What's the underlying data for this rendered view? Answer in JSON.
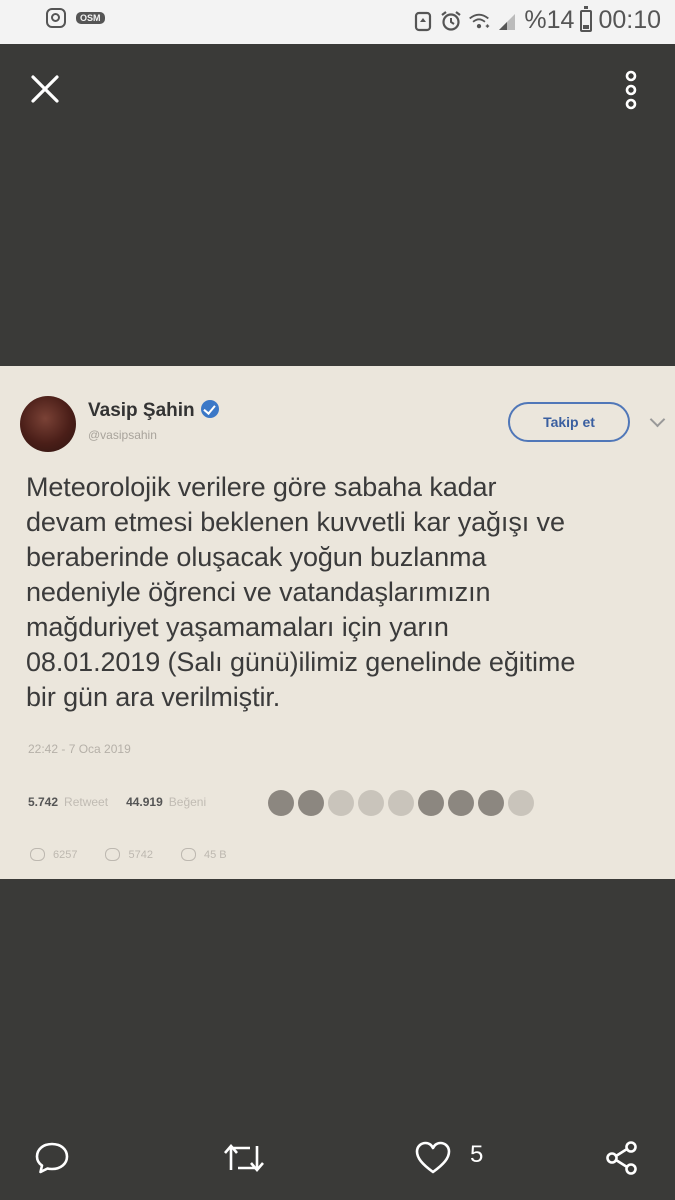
{
  "status_bar": {
    "left_icons": [
      "instagram-icon",
      "osm-app-icon"
    ],
    "osm_label": "OSM",
    "battery_text": "%14",
    "time": "00:10",
    "right_icons": [
      "recycle-icon",
      "alarm-icon",
      "wifi-icon",
      "signal-icon",
      "battery-icon"
    ]
  },
  "viewer": {
    "close_icon": "close-icon",
    "menu_icon": "more-vert-icon"
  },
  "tweet_photo": {
    "user_name": "Vasip Şahin",
    "verified_icon": "verified-badge-icon",
    "handle": "@vasipsahin",
    "follow_label": "Takip et",
    "caret_icon": "chevron-down-icon",
    "text": "Meteorolojik verilere göre sabaha kadar\ndevam etmesi beklenen kuvvetli kar yağışı ve\nberaberinde oluşacak yoğun buzlanma\nnedeniyle öğrenci ve vatandaşlarımızın\nmağduriyet yaşamamaları için yarın\n08.01.2019 (Salı günü)ilimiz genelinde eğitime\nbir gün ara verilmiştir.",
    "timestamp": "22:42 - 7 Oca 2019",
    "retweets_count": "5.742",
    "retweets_label": "Retweet",
    "likes_count": "44.919",
    "likes_label": "Beğeni",
    "reply_count": "6257",
    "retweet_action_count": "5742",
    "like_action_count": "45 B"
  },
  "bottom_actions": {
    "reply_icon": "reply-bubble-icon",
    "retweet_icon": "retweet-icon",
    "like_icon": "heart-icon",
    "like_count": "5",
    "share_icon": "share-icon"
  }
}
